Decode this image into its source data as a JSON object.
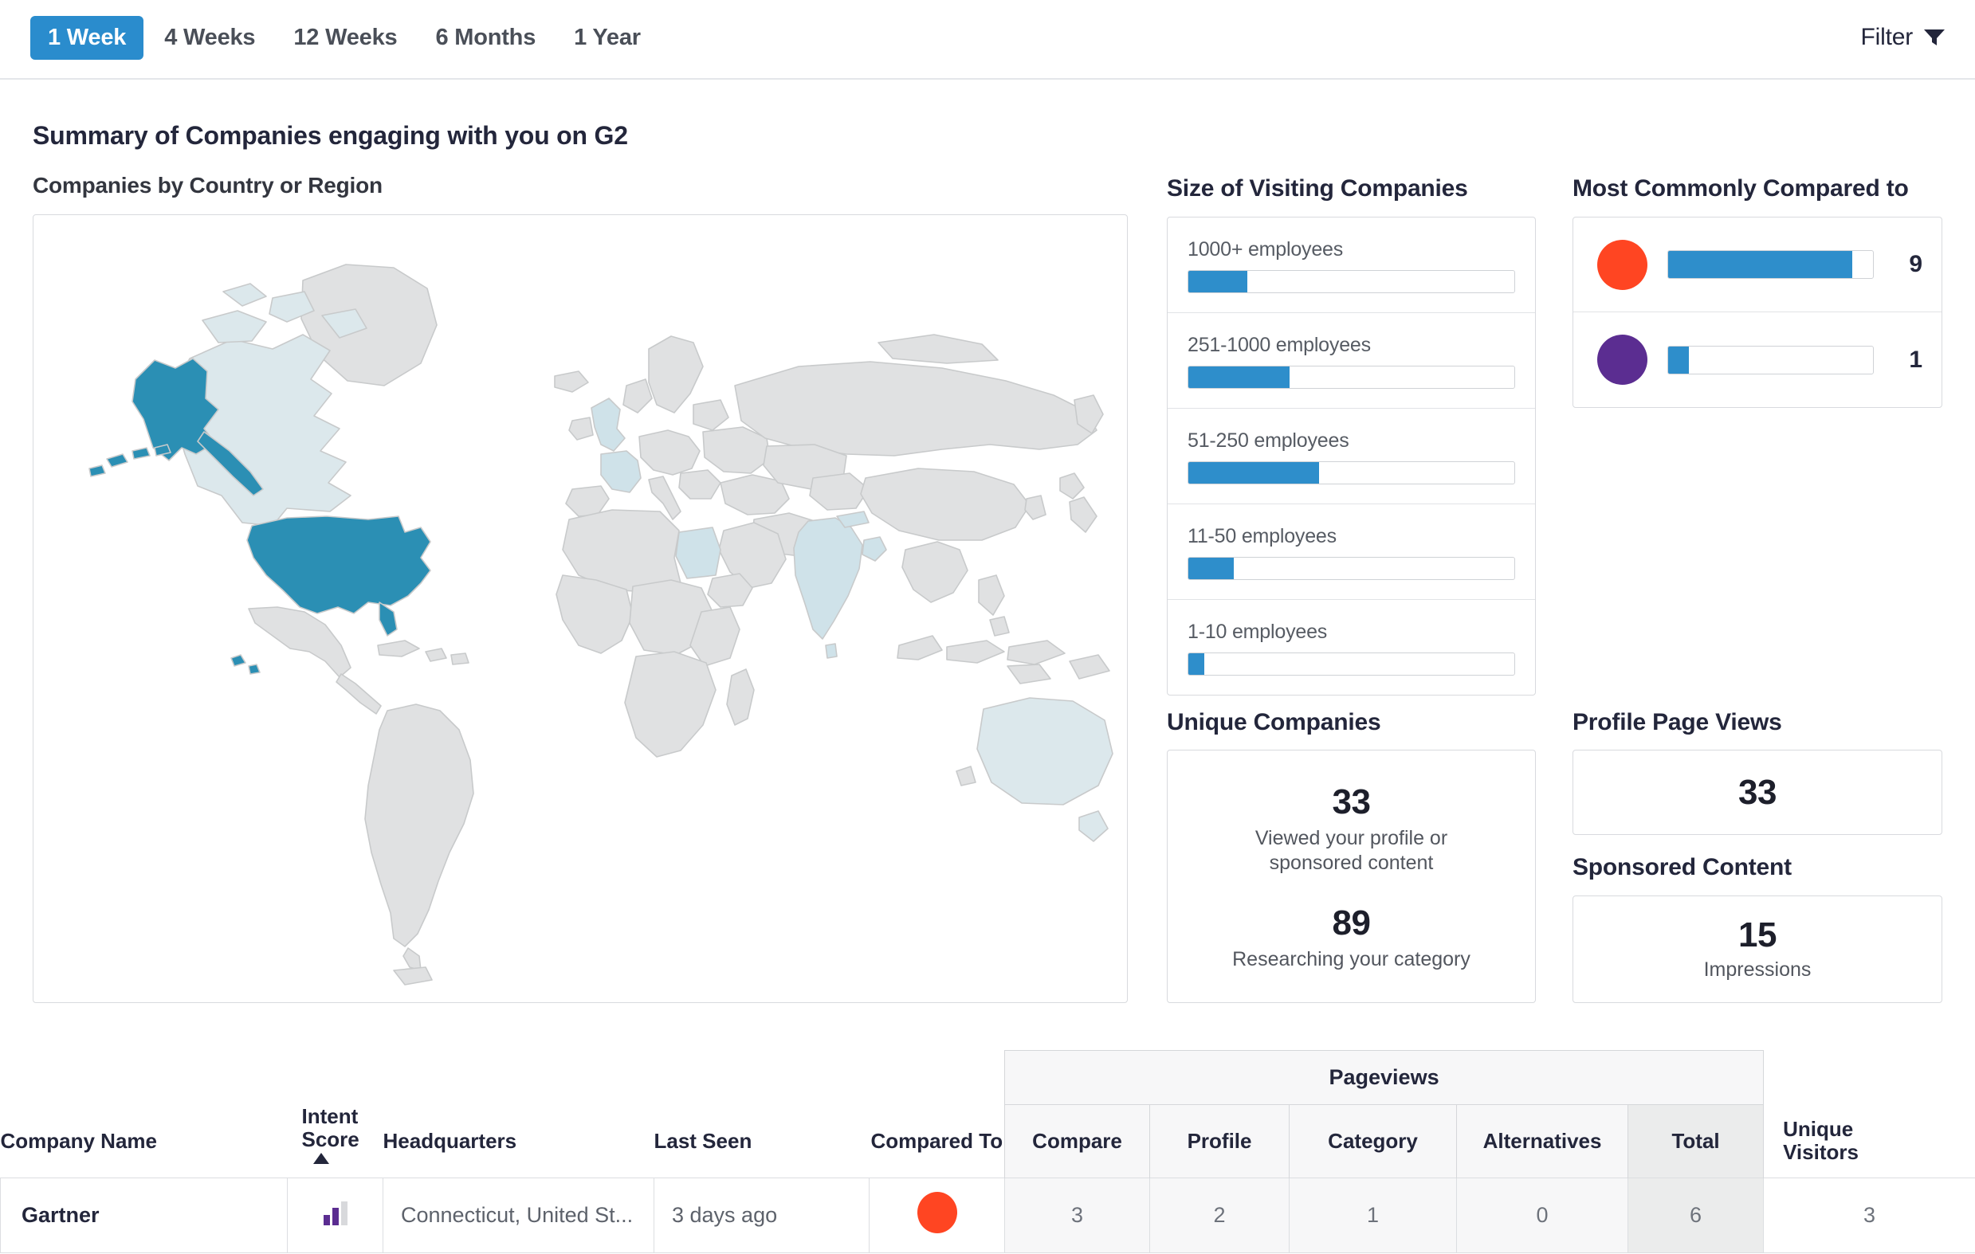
{
  "topbar": {
    "tabs": [
      {
        "label": "1 Week",
        "active": true
      },
      {
        "label": "4 Weeks",
        "active": false
      },
      {
        "label": "12 Weeks",
        "active": false
      },
      {
        "label": "6 Months",
        "active": false
      },
      {
        "label": "1 Year",
        "active": false
      }
    ],
    "filter_label": "Filter",
    "filter_icon": "funnel-icon"
  },
  "page_title": "Summary of Companies engaging with you on G2",
  "map": {
    "title": "Companies by Country or Region",
    "legend_min": "1",
    "legend_max": "66",
    "colors": {
      "high": "#2b8fb4",
      "mid": "#8ec4d6",
      "low": "#dce8ec",
      "none": "#e0e1e2",
      "stroke": "#c8cacb"
    }
  },
  "size_panel": {
    "title": "Size of Visiting Companies",
    "bar_color": "#2e8ecb",
    "rows": [
      {
        "label": "1000+ employees",
        "percent": 18
      },
      {
        "label": "251-1000 employees",
        "percent": 31
      },
      {
        "label": "51-250 employees",
        "percent": 40
      },
      {
        "label": "11-50 employees",
        "percent": 14
      },
      {
        "label": "1-10 employees",
        "percent": 5
      }
    ]
  },
  "compared_panel": {
    "title": "Most Commonly Compared to",
    "bar_color": "#2e8ecb",
    "rows": [
      {
        "dot_color": "#ff4522",
        "percent": 90,
        "value": "9"
      },
      {
        "dot_color": "#5b2d91",
        "percent": 10,
        "value": "1"
      }
    ]
  },
  "unique_companies": {
    "title": "Unique Companies",
    "metrics": [
      {
        "value": "33",
        "label": "Viewed your profile or sponsored content"
      },
      {
        "value": "89",
        "label": "Researching your category"
      }
    ]
  },
  "profile_page_views": {
    "title": "Profile Page Views",
    "value": "33"
  },
  "sponsored_content": {
    "title": "Sponsored Content",
    "value": "15",
    "label": "Impressions"
  },
  "table": {
    "group_header": "Pageviews",
    "columns": {
      "company_name": "Company Name",
      "intent_score": "Intent Score",
      "headquarters": "Headquarters",
      "last_seen": "Last Seen",
      "compared_to": "Compared To",
      "compare": "Compare",
      "profile": "Profile",
      "category": "Category",
      "alternatives": "Alternatives",
      "total": "Total",
      "unique_visitors": "Unique Visitors"
    },
    "sort": {
      "column": "intent_score",
      "direction": "asc",
      "icon": "caret-up-icon"
    },
    "rows": [
      {
        "company_name": "Gartner",
        "intent_score_icon": "bar-chart-icon",
        "headquarters": "Connecticut, United St...",
        "last_seen": "3 days ago",
        "compared_to_color": "#ff4522",
        "compare": "3",
        "profile": "2",
        "category": "1",
        "alternatives": "0",
        "total": "6",
        "unique_visitors": "3"
      }
    ]
  }
}
